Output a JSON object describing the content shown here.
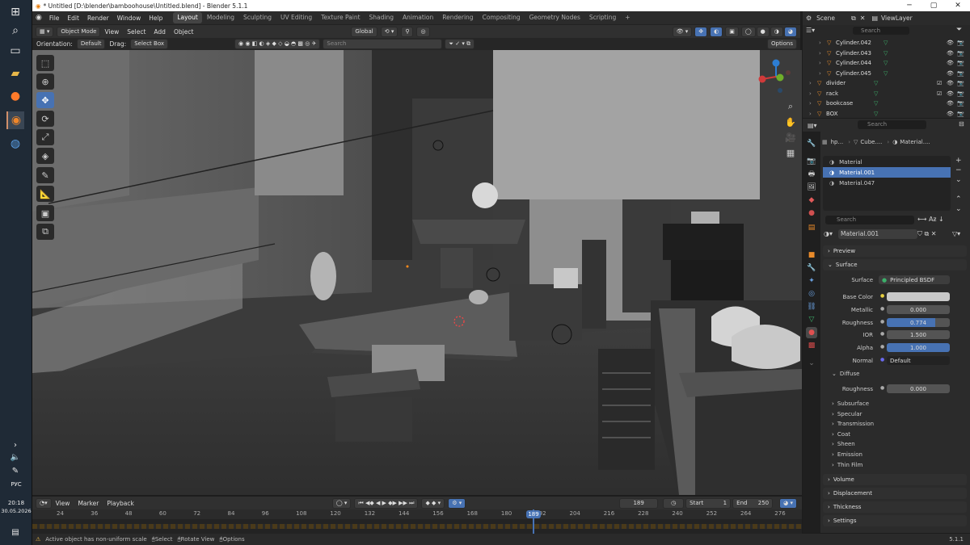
{
  "window": {
    "title": "* Untitled [D:\\blender\\bamboohouse\\Untitled.blend] - Blender 5.1.1"
  },
  "menu": {
    "items": [
      "File",
      "Edit",
      "Render",
      "Window",
      "Help"
    ]
  },
  "workspaces": [
    "Layout",
    "Modeling",
    "Sculpting",
    "UV Editing",
    "Texture Paint",
    "Shading",
    "Animation",
    "Rendering",
    "Compositing",
    "Geometry Nodes",
    "Scripting"
  ],
  "scene": {
    "scene_label": "Scene",
    "viewlayer_label": "ViewLayer"
  },
  "viewport_header": {
    "mode": "Object Mode",
    "view": "View",
    "select": "Select",
    "add": "Add",
    "object": "Object",
    "transform": "Global",
    "options": "Options"
  },
  "viewport_header2": {
    "orientation_label": "Orientation:",
    "orientation_value": "Default",
    "drag_label": "Drag:",
    "drag_value": "Select Box",
    "search_placeholder": "Search"
  },
  "outliner": {
    "search_placeholder": "Search",
    "rows": [
      {
        "name": "Cylinder.042"
      },
      {
        "name": "Cylinder.043"
      },
      {
        "name": "Cylinder.044"
      },
      {
        "name": "Cylinder.045"
      },
      {
        "name": "divider"
      },
      {
        "name": "rack"
      },
      {
        "name": "bookcase"
      },
      {
        "name": "BOX"
      }
    ]
  },
  "properties": {
    "search_placeholder": "Search",
    "breadcrumb": [
      "hp...",
      "Cube....",
      "Material...."
    ],
    "material_slots": [
      "Material",
      "Material.001",
      "Material.047"
    ],
    "active_slot": "Material.001",
    "slot_search_placeholder": "Search",
    "material_name": "Material.001",
    "sections": {
      "preview": "Preview",
      "surface": "Surface",
      "volume": "Volume",
      "displacement": "Displacement",
      "thickness": "Thickness",
      "settings": "Settings"
    },
    "surface_label": "Surface",
    "surface_value": "Principled BSDF",
    "params": [
      {
        "label": "Base Color",
        "value": ""
      },
      {
        "label": "Metallic",
        "value": "0.000"
      },
      {
        "label": "Roughness",
        "value": "0.774"
      },
      {
        "label": "IOR",
        "value": "1.500"
      },
      {
        "label": "Alpha",
        "value": "1.000"
      },
      {
        "label": "Normal",
        "value": "Default"
      }
    ],
    "diffuse_label": "Diffuse",
    "diffuse_roughness_label": "Roughness",
    "diffuse_roughness_value": "0.000",
    "subpanels": [
      "Subsurface",
      "Specular",
      "Transmission",
      "Coat",
      "Sheen",
      "Emission",
      "Thin Film"
    ]
  },
  "timeline": {
    "view": "View",
    "marker": "Marker",
    "playback": "Playback",
    "current_frame": "189",
    "start_label": "Start",
    "start": "1",
    "end_label": "End",
    "end": "250",
    "ticks": [
      "24",
      "36",
      "48",
      "60",
      "72",
      "84",
      "96",
      "108",
      "120",
      "132",
      "144",
      "156",
      "168",
      "180",
      "192",
      "204",
      "216",
      "228",
      "240",
      "252",
      "264",
      "276"
    ]
  },
  "status": {
    "message": "Active object has non-uniform scale",
    "select": "Select",
    "rotate": "Rotate View",
    "options": "Options",
    "version": "5.1.1"
  },
  "taskbar": {
    "lang": "РУС",
    "time": "20:18",
    "date": "30.05.2026"
  },
  "colors": {
    "accent": "#4772b3",
    "bg": "#2b2b2b",
    "panel": "#303030"
  }
}
